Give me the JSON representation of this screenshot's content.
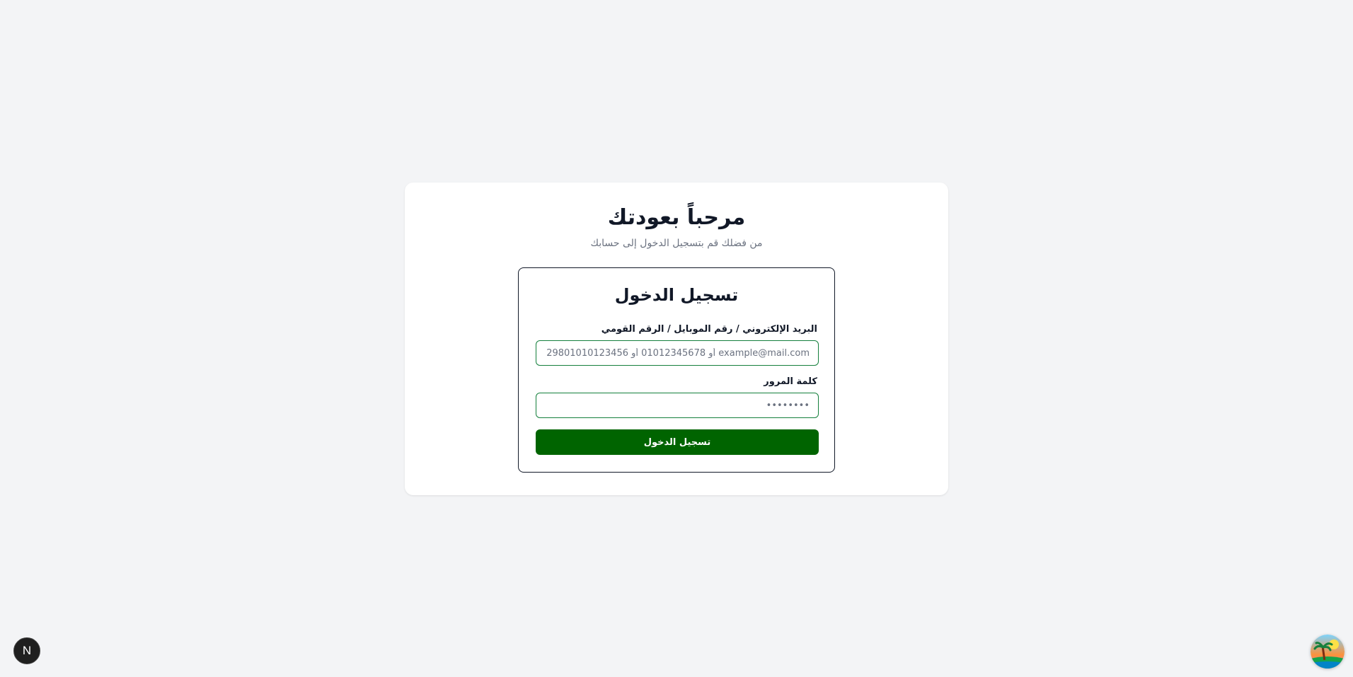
{
  "welcome": {
    "title": "مرحباً بعودتك",
    "subtitle": "من فضلك قم بتسجيل الدخول إلى حسابك"
  },
  "login": {
    "title": "تسجيل الدخول",
    "identifier_label": "البريد الإلكتروني / رقم الموبايل / الرقم القومي",
    "identifier_placeholder": "example@mail.com أو 01012345678 أو 29801010123456",
    "identifier_value": "",
    "password_label": "كلمة المرور",
    "password_placeholder": "••••••••",
    "password_value": "",
    "submit_label": "تسجيل الدخول"
  },
  "overlay": {
    "dev_badge_letter": "N",
    "dev_badge_icon": "nextjs-icon",
    "assistant_icon": "palm-island-icon"
  },
  "colors": {
    "page_bg": "#f3f4f6",
    "accent_green": "#006400",
    "input_border": "#15803d",
    "title_text": "#111827",
    "muted_text": "#6b7280"
  }
}
